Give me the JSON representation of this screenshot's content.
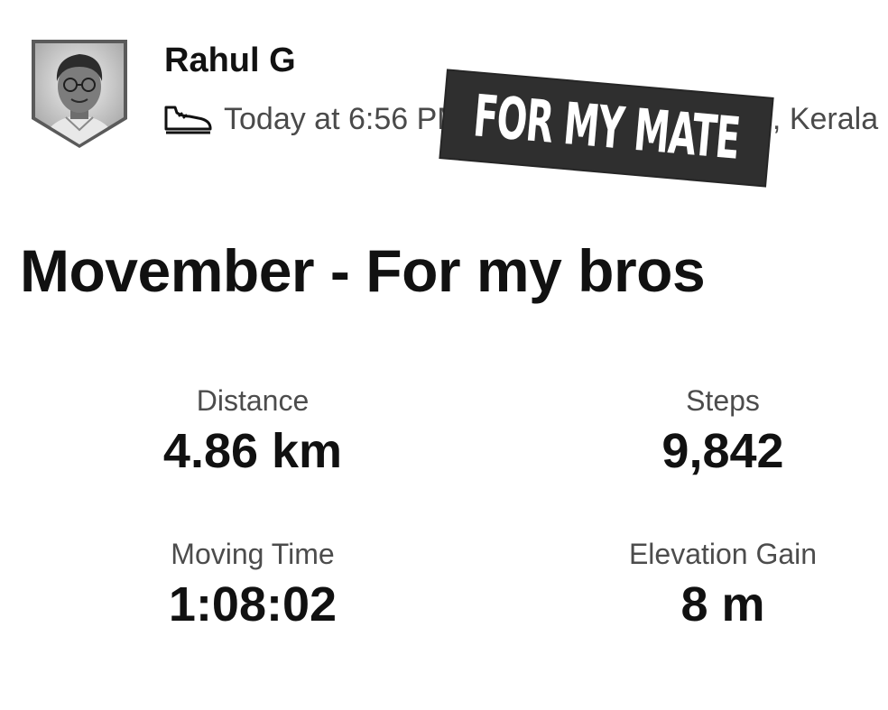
{
  "athlete": {
    "name": "Rahul G",
    "avatar_icon": "profile-photo-shield"
  },
  "activity_meta": {
    "icon": "shoe-icon",
    "text": "Today at 6:56 PM · Thiruvananthapuram, Kerala"
  },
  "sticker": {
    "text": "FOR MY MATE",
    "background": "#2f2f2f",
    "color": "#ffffff"
  },
  "activity": {
    "title": "Movember - For my bros"
  },
  "stats": {
    "distance": {
      "label": "Distance",
      "value": "4.86 km"
    },
    "steps": {
      "label": "Steps",
      "value": "9,842"
    },
    "moving_time": {
      "label": "Moving Time",
      "value": "1:08:02"
    },
    "elevation_gain": {
      "label": "Elevation Gain",
      "value": "8 m"
    }
  }
}
